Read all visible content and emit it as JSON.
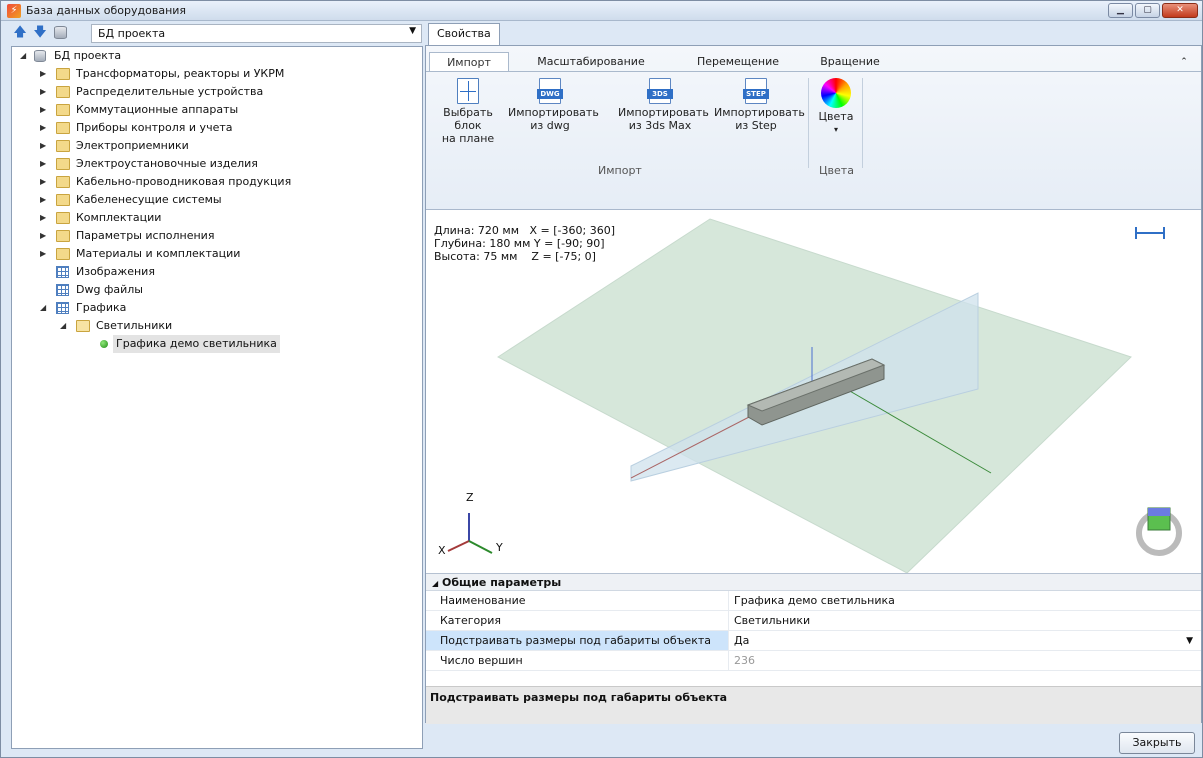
{
  "window": {
    "title": "База данных оборудования",
    "controls": [
      "minimize-icon",
      "maximize-icon",
      "close-icon"
    ]
  },
  "left_panel": {
    "toolbar": {
      "icons": [
        "arrow-up-icon",
        "arrow-down-icon",
        "database-icon"
      ],
      "db_select_value": "БД проекта"
    },
    "tree": {
      "root": "БД проекта",
      "items": [
        "Трансформаторы, реакторы и УКРМ",
        "Распределительные устройства",
        "Коммутационные аппараты",
        "Приборы контроля и учета",
        "Электроприемники",
        "Электроустановочные изделия",
        "Кабельно-проводниковая продукция",
        "Кабеленесущие системы",
        "Комплектации",
        "Параметры исполнения",
        "Материалы и комплектации",
        "Изображения",
        "Dwg файлы",
        "Графика",
        "Светильники",
        "Графика демо светильника"
      ]
    }
  },
  "right_panel": {
    "tab": "Свойства",
    "ribbon": {
      "tabs": [
        "Импорт",
        "Масштабирование",
        "Перемещение",
        "Вращение"
      ],
      "buttons": {
        "select_block": [
          "Выбрать блок",
          "на плане"
        ],
        "import_dwg": [
          "Импортировать",
          "из dwg"
        ],
        "import_3ds": [
          "Импортировать",
          "из 3ds Max"
        ],
        "import_step": [
          "Импортировать",
          "из Step"
        ],
        "colors": "Цвета"
      },
      "file_tags": {
        "dwg": "DWG",
        "max": "3DS",
        "step": "STEP"
      },
      "groups": {
        "import": "Импорт",
        "colors": "Цвета"
      }
    },
    "viewport": {
      "dims": [
        "Длина: 720 мм   X = [-360; 360]",
        "Глубина: 180 мм Y = [-90; 90]",
        "Высота: 75 мм    Z = [-75; 0]"
      ],
      "axes": {
        "x": "X",
        "y": "Y",
        "z": "Z"
      }
    },
    "properties": {
      "category": "Общие параметры",
      "rows": [
        {
          "key": "Наименование",
          "value": "Графика демо светильника"
        },
        {
          "key": "Категория",
          "value": "Светильники"
        },
        {
          "key": "Подстраивать размеры под габариты объекта",
          "value": "Да"
        },
        {
          "key": "Число вершин",
          "value": "236"
        }
      ],
      "description": "Подстраивать размеры под габариты объекта"
    }
  },
  "footer": {
    "close_label": "Закрыть"
  },
  "colors": {
    "accent": "#3399ff",
    "selection": "#cde4fb",
    "plane": "#d6e7da"
  }
}
